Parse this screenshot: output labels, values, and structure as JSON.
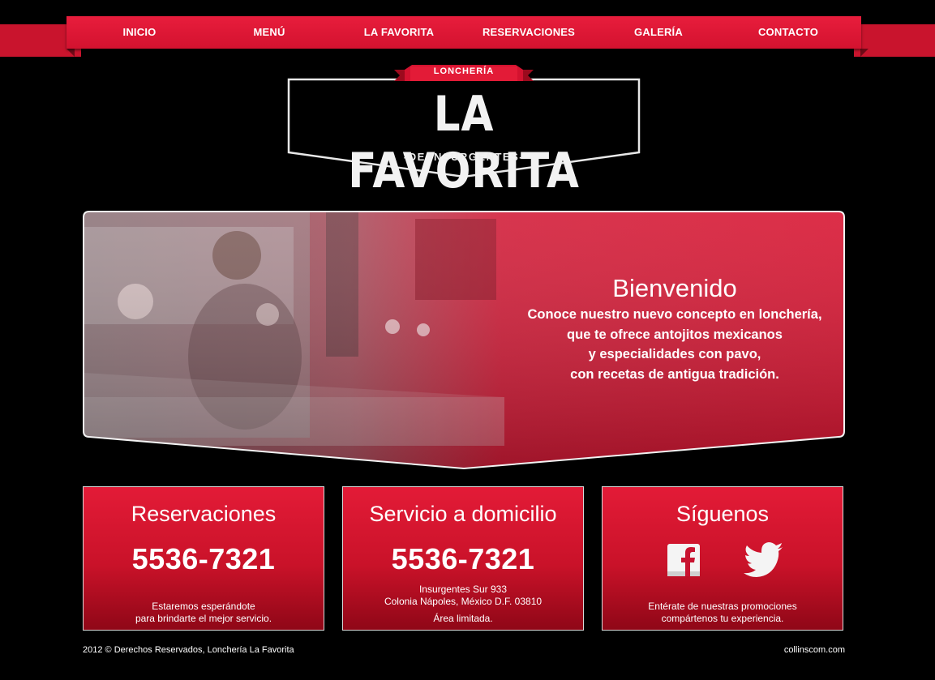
{
  "nav": {
    "items": [
      {
        "label": "INICIO"
      },
      {
        "label": "MENÚ"
      },
      {
        "label": "LA FAVORITA"
      },
      {
        "label": "RESERVACIONES"
      },
      {
        "label": "GALERÍA"
      },
      {
        "label": "CONTACTO"
      }
    ]
  },
  "logo": {
    "banner": "LONCHERÍA",
    "title": "LA FAVORITA",
    "subtitle": "-DE INSURGENTES-"
  },
  "hero": {
    "title": "Bienvenido",
    "lines": [
      "Conoce nuestro nuevo concepto en lonchería,",
      "que te ofrece antojitos mexicanos",
      "y especialidades con pavo,",
      "con recetas de antigua tradición."
    ]
  },
  "cards": {
    "reservations": {
      "title": "Reservaciones",
      "phone": "5536-7321",
      "note_lines": [
        "Estaremos esperándote",
        "para brindarte el mejor servicio."
      ]
    },
    "delivery": {
      "title": "Servicio a domicilio",
      "phone": "5536-7321",
      "address_lines": [
        "Insurgentes Sur 933",
        "Colonia Nápoles, México D.F. 03810"
      ],
      "limited": "Área limitada."
    },
    "social": {
      "title": "Síguenos",
      "icons": [
        "facebook-icon",
        "twitter-icon"
      ],
      "note_lines": [
        "Entérate de nuestras promociones",
        "compártenos tu experiencia."
      ]
    }
  },
  "footer": {
    "copyright": "2012 © Derechos Reservados, Lonchería La Favorita",
    "credit": "collinscom.com"
  },
  "colors": {
    "brand_red": "#e31b37",
    "dark_red": "#8f0717",
    "background": "#000000"
  }
}
